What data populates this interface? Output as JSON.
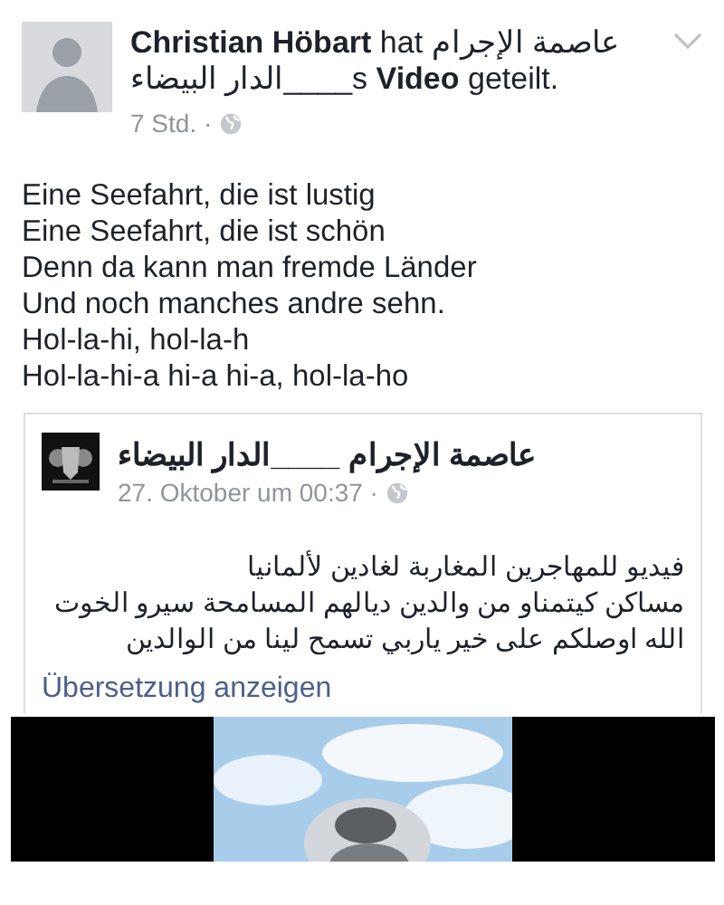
{
  "post": {
    "header": "**Christian Höbart** hat عاصمة الإجرام ____الدار البيضاءs **Video** geteilt.",
    "time": "7 Std. ·",
    "body": [
      "Eine Seefahrt, die ist lustig",
      "Eine Seefahrt, die ist schön",
      "Denn da kann man fremde Länder",
      "Und noch manches andre sehn.",
      "Hol-la-hi, hol-la-h",
      "Hol-la-hi-a hi-a hi-a, hol-la-ho"
    ],
    "shared": {
      "page": "عاصمة الإجرام ____الدار البيضاء",
      "time": "27. Oktober um 00:37 ·",
      "text": [
        "فيديو للمهاجرين المغاربة لغادين لألمانيا",
        "مساكن كيتمناو من والدين ديالهم المسامحة سيرو الخوت",
        "الله اوصلكم على خير ياربي تسمح لينا من الوالدين"
      ],
      "translate_link": "Übersetzung anzeigen"
    }
  }
}
